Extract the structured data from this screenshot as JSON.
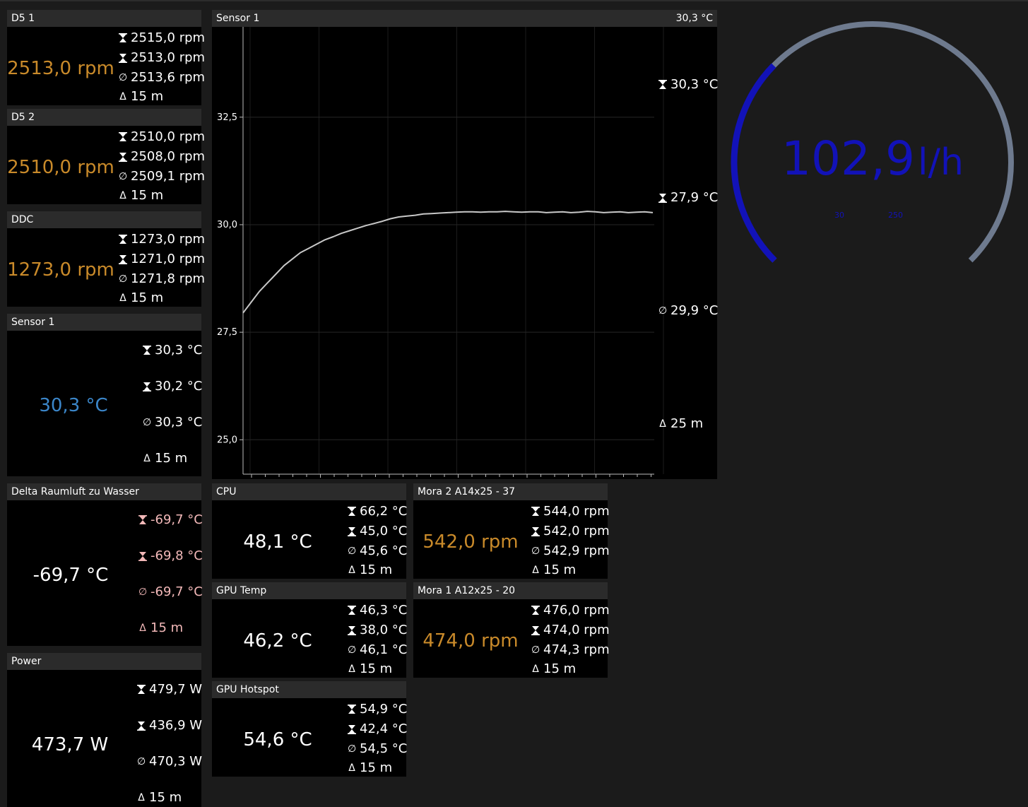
{
  "panels": {
    "d5_1": {
      "title": "D5 1",
      "value": "2513,0 rpm",
      "max": "2515,0 rpm",
      "min": "2513,0 rpm",
      "avg": "2513,6 rpm",
      "dt": "15 m"
    },
    "d5_2": {
      "title": "D5 2",
      "value": "2510,0 rpm",
      "max": "2510,0 rpm",
      "min": "2508,0 rpm",
      "avg": "2509,1 rpm",
      "dt": "15 m"
    },
    "ddc": {
      "title": "DDC",
      "value": "1273,0 rpm",
      "max": "1273,0 rpm",
      "min": "1271,0 rpm",
      "avg": "1271,8 rpm",
      "dt": "15 m"
    },
    "sensor1": {
      "title": "Sensor 1",
      "value": "30,3 °C",
      "max": "30,3 °C",
      "min": "30,2 °C",
      "avg": "30,3 °C",
      "dt": "15 m"
    },
    "delta": {
      "title": "Delta Raumluft zu Wasser",
      "value": "-69,7 °C",
      "max": "-69,7 °C",
      "min": "-69,8 °C",
      "avg": "-69,7 °C",
      "dt": "15 m"
    },
    "power": {
      "title": "Power",
      "value": "473,7 W",
      "max": "479,7 W",
      "min": "436,9 W",
      "avg": "470,3 W",
      "dt": "15 m"
    },
    "cpu": {
      "title": "CPU",
      "value": "48,1 °C",
      "max": "66,2 °C",
      "min": "45,0 °C",
      "avg": "45,6 °C",
      "dt": "15 m"
    },
    "gpu_temp": {
      "title": "GPU Temp",
      "value": "46,2 °C",
      "max": "46,3 °C",
      "min": "38,0 °C",
      "avg": "46,1 °C",
      "dt": "15 m"
    },
    "gpu_hotspot": {
      "title": "GPU Hotspot",
      "value": "54,6 °C",
      "max": "54,9 °C",
      "min": "42,4 °C",
      "avg": "54,5 °C",
      "dt": "15 m"
    },
    "mora2": {
      "title": "Mora 2 A14x25 - 37",
      "value": "542,0 rpm",
      "max": "544,0 rpm",
      "min": "542,0 rpm",
      "avg": "542,9 rpm",
      "dt": "15 m"
    },
    "mora1": {
      "title": "Mora 1 A12x25 - 20",
      "value": "474,0 rpm",
      "max": "476,0 rpm",
      "min": "474,0 rpm",
      "avg": "474,3 rpm",
      "dt": "15 m"
    }
  },
  "chart_panel": {
    "title": "Sensor 1",
    "current": "30,3 °C",
    "max": "30,3 °C",
    "min": "27,9 °C",
    "avg": "29,9 °C",
    "dt": "25 m"
  },
  "chart_data": {
    "type": "line",
    "title": "Sensor 1",
    "xlabel": "",
    "ylabel": "",
    "ylim": [
      24.2,
      34.6
    ],
    "yticks": [
      "25,0",
      "27,5",
      "30,0",
      "32,5"
    ],
    "ytick_values": [
      25.0,
      27.5,
      30.0,
      32.5
    ],
    "xlim": [
      0,
      100
    ],
    "grid": true,
    "series": [
      {
        "color": "#c8c8c8",
        "x": [
          0,
          2,
          4,
          6,
          8,
          10,
          12,
          14,
          16,
          18,
          20,
          22,
          24,
          26,
          28,
          30,
          32,
          34,
          36,
          38,
          40,
          42,
          44,
          46,
          48,
          50,
          52,
          54,
          56,
          58,
          60,
          62,
          64,
          66,
          68,
          70,
          72,
          74,
          76,
          78,
          80,
          82,
          84,
          86,
          88,
          90,
          92,
          94,
          96,
          98,
          100
        ],
        "y": [
          27.95,
          28.2,
          28.45,
          28.65,
          28.85,
          29.05,
          29.2,
          29.35,
          29.45,
          29.55,
          29.65,
          29.72,
          29.8,
          29.86,
          29.92,
          29.98,
          30.03,
          30.08,
          30.14,
          30.18,
          30.2,
          30.22,
          30.25,
          30.26,
          30.27,
          30.28,
          30.29,
          30.3,
          30.3,
          30.29,
          30.3,
          30.3,
          30.31,
          30.3,
          30.29,
          30.3,
          30.3,
          30.28,
          30.29,
          30.3,
          30.28,
          30.29,
          30.31,
          30.3,
          30.28,
          30.29,
          30.3,
          30.28,
          30.29,
          30.3,
          30.28
        ]
      }
    ]
  },
  "gauge": {
    "value": "102,9",
    "unit": "l/h",
    "range_min_label": "30",
    "range_max_label": "250",
    "range_min": 30,
    "range_max": 250,
    "reading": 102.9,
    "color_active": "#1212b8",
    "color_track": "#6e7a8e"
  },
  "colors": {
    "rpm": "#c98a2a",
    "temp_blue": "#3b86c9",
    "header_bg": "#2b2b2b"
  }
}
